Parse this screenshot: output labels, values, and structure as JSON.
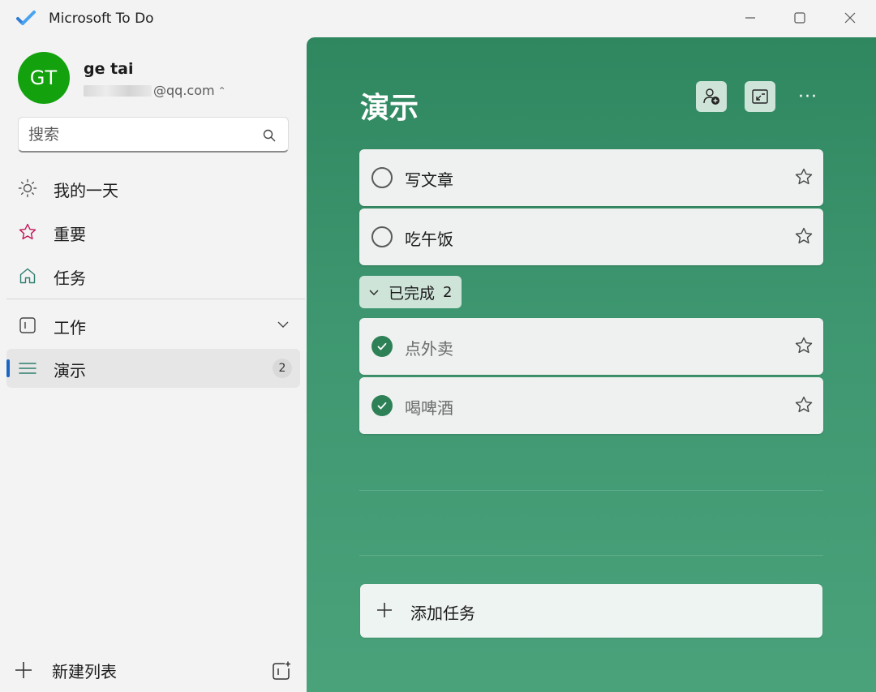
{
  "window": {
    "title": "Microsoft To Do"
  },
  "user": {
    "initials": "GT",
    "name": "ge tai",
    "email_suffix": "@qq.com"
  },
  "search": {
    "placeholder": "搜索"
  },
  "sidebar": {
    "items": [
      {
        "label": "我的一天",
        "icon": "sun-icon"
      },
      {
        "label": "重要",
        "icon": "star-icon"
      },
      {
        "label": "任务",
        "icon": "home-icon"
      },
      {
        "label": "工作",
        "icon": "group-icon"
      },
      {
        "label": "演示",
        "icon": "list-icon",
        "count": "2"
      }
    ],
    "new_list_label": "新建列表"
  },
  "colors": {
    "accent": "#1a66c2",
    "avatar": "#13a10e",
    "theme_top": "#2f8760",
    "theme_bottom": "#4aa27b",
    "completed_check": "#2e8157",
    "important_star": "#c2185b",
    "task_icon": "#2e7d6f"
  },
  "main": {
    "title": "演示",
    "tasks": [
      {
        "title": "写文章",
        "completed": false
      },
      {
        "title": "吃午饭",
        "completed": false
      }
    ],
    "completed_group": {
      "label": "已完成",
      "count": "2"
    },
    "completed_tasks": [
      {
        "title": "点外卖",
        "completed": true
      },
      {
        "title": "喝啤酒",
        "completed": true
      }
    ],
    "add_task_label": "添加任务",
    "more_label": "···"
  }
}
